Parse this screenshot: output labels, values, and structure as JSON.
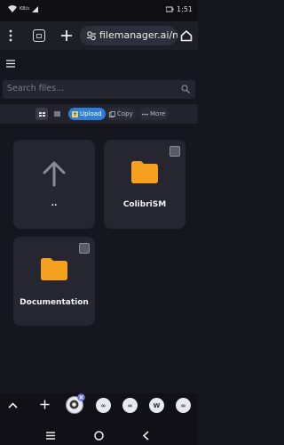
{
  "status": {
    "time": "1:51",
    "left_info": "KB/s"
  },
  "browser": {
    "url": "filemanager.ai/ne"
  },
  "app": {
    "search_placeholder": "Search files...",
    "actions": {
      "upload": "Upload",
      "copy": "Copy",
      "more": "More"
    },
    "items": [
      {
        "label": "..",
        "type": "parent"
      },
      {
        "label": "ColibriSM",
        "type": "folder"
      },
      {
        "label": "Documentation",
        "type": "folder"
      }
    ]
  },
  "colors": {
    "folder": "#f6a020",
    "accent": "#2f7fd6",
    "background": "#16161e"
  }
}
